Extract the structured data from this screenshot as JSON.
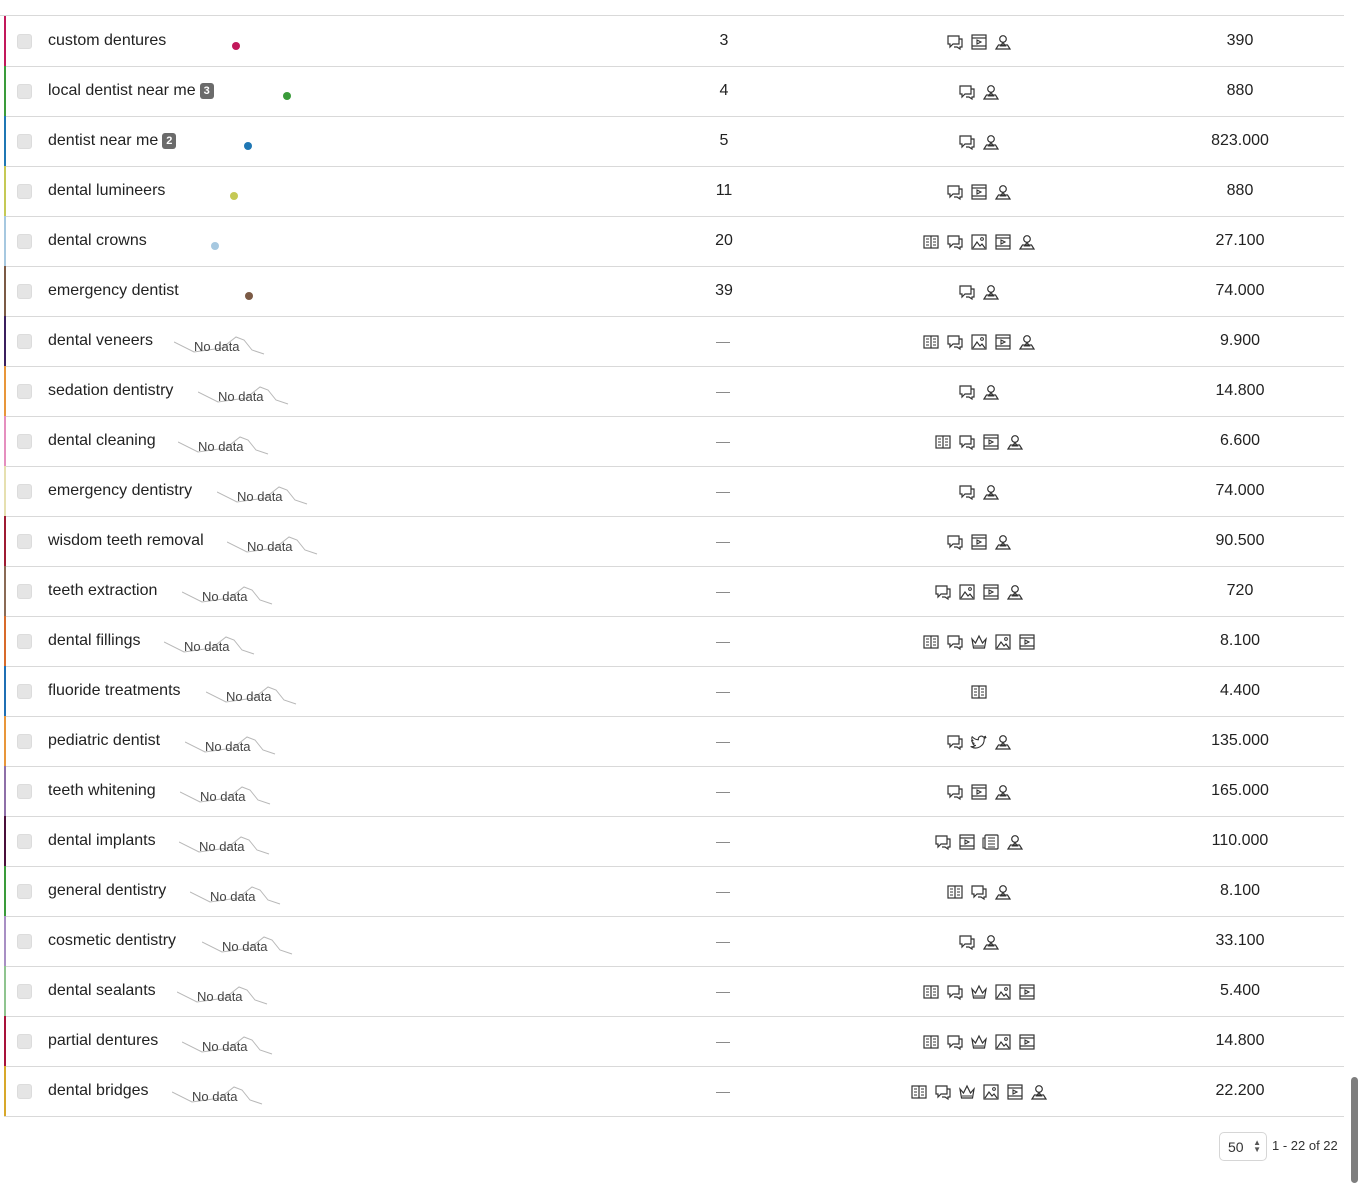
{
  "table": {
    "no_data_label": "No data",
    "rows": [
      {
        "keyword": "custom dentures",
        "badge": "",
        "position": "3",
        "volume": "390",
        "color": "#c2185b",
        "icons": [
          "ads-icon",
          "video-icon",
          "local-pack-icon"
        ],
        "trend": "dot"
      },
      {
        "keyword": "local dentist near me",
        "badge": "3",
        "position": "4",
        "volume": "880",
        "color": "#3a9b3a",
        "icons": [
          "ads-icon",
          "local-pack-icon"
        ],
        "trend": "dot"
      },
      {
        "keyword": "dentist near me",
        "badge": "2",
        "position": "5",
        "volume": "823.000",
        "color": "#1f77b4",
        "icons": [
          "ads-icon",
          "local-pack-icon"
        ],
        "trend": "dot"
      },
      {
        "keyword": "dental lumineers",
        "badge": "",
        "position": "11",
        "volume": "880",
        "color": "#c5c955",
        "icons": [
          "ads-icon",
          "video-icon",
          "local-pack-icon"
        ],
        "trend": "dot"
      },
      {
        "keyword": "dental crowns",
        "badge": "",
        "position": "20",
        "volume": "27.100",
        "color": "#a6c8e0",
        "icons": [
          "knowledge-panel-icon",
          "ads-icon",
          "image-pack-icon",
          "video-icon",
          "local-pack-icon"
        ],
        "trend": "dot"
      },
      {
        "keyword": "emergency dentist",
        "badge": "",
        "position": "39",
        "volume": "74.000",
        "color": "#7b5a45",
        "icons": [
          "ads-icon",
          "local-pack-icon"
        ],
        "trend": "dot"
      },
      {
        "keyword": "dental veneers",
        "badge": "",
        "position": "",
        "volume": "9.900",
        "color": "#3b1f5e",
        "icons": [
          "knowledge-panel-icon",
          "ads-icon",
          "image-pack-icon",
          "video-icon",
          "local-pack-icon"
        ],
        "trend": "nodata"
      },
      {
        "keyword": "sedation dentistry",
        "badge": "",
        "position": "",
        "volume": "14.800",
        "color": "#e8963a",
        "icons": [
          "ads-icon",
          "local-pack-icon"
        ],
        "trend": "nodata"
      },
      {
        "keyword": "dental cleaning",
        "badge": "",
        "position": "",
        "volume": "6.600",
        "color": "#e58fbf",
        "icons": [
          "knowledge-panel-icon",
          "ads-icon",
          "video-icon",
          "local-pack-icon"
        ],
        "trend": "nodata"
      },
      {
        "keyword": "emergency dentistry",
        "badge": "",
        "position": "",
        "volume": "74.000",
        "color": "#e6e0b0",
        "icons": [
          "ads-icon",
          "local-pack-icon"
        ],
        "trend": "nodata"
      },
      {
        "keyword": "wisdom teeth removal",
        "badge": "",
        "position": "",
        "volume": "90.500",
        "color": "#9e1b32",
        "icons": [
          "ads-icon",
          "video-icon",
          "local-pack-icon"
        ],
        "trend": "nodata"
      },
      {
        "keyword": "teeth extraction",
        "badge": "",
        "position": "",
        "volume": "720",
        "color": "#8a6a55",
        "icons": [
          "ads-icon",
          "image-pack-icon",
          "video-icon",
          "local-pack-icon"
        ],
        "trend": "nodata"
      },
      {
        "keyword": "dental fillings",
        "badge": "",
        "position": "",
        "volume": "8.100",
        "color": "#d86a2a",
        "icons": [
          "knowledge-panel-icon",
          "ads-icon",
          "crown-icon",
          "image-pack-icon",
          "video-icon"
        ],
        "trend": "nodata"
      },
      {
        "keyword": "fluoride treatments",
        "badge": "",
        "position": "",
        "volume": "4.400",
        "color": "#1f6fb4",
        "icons": [
          "knowledge-panel-icon"
        ],
        "trend": "nodata"
      },
      {
        "keyword": "pediatric dentist",
        "badge": "",
        "position": "",
        "volume": "135.000",
        "color": "#e8963a",
        "icons": [
          "ads-icon",
          "twitter-icon",
          "local-pack-icon"
        ],
        "trend": "nodata"
      },
      {
        "keyword": "teeth whitening",
        "badge": "",
        "position": "",
        "volume": "165.000",
        "color": "#8e6fa8",
        "icons": [
          "ads-icon",
          "video-icon",
          "local-pack-icon"
        ],
        "trend": "nodata"
      },
      {
        "keyword": "dental implants",
        "badge": "",
        "position": "",
        "volume": "110.000",
        "color": "#4a0f3a",
        "icons": [
          "ads-icon",
          "video-icon",
          "news-icon",
          "local-pack-icon"
        ],
        "trend": "nodata"
      },
      {
        "keyword": "general dentistry",
        "badge": "",
        "position": "",
        "volume": "8.100",
        "color": "#3a9b3a",
        "icons": [
          "knowledge-panel-icon",
          "ads-icon",
          "local-pack-icon"
        ],
        "trend": "nodata"
      },
      {
        "keyword": "cosmetic dentistry",
        "badge": "",
        "position": "",
        "volume": "33.100",
        "color": "#a88fc4",
        "icons": [
          "ads-icon",
          "local-pack-icon"
        ],
        "trend": "nodata"
      },
      {
        "keyword": "dental sealants",
        "badge": "",
        "position": "",
        "volume": "5.400",
        "color": "#8fc48f",
        "icons": [
          "knowledge-panel-icon",
          "ads-icon",
          "crown-icon",
          "image-pack-icon",
          "video-icon"
        ],
        "trend": "nodata"
      },
      {
        "keyword": "partial dentures",
        "badge": "",
        "position": "",
        "volume": "14.800",
        "color": "#a8123a",
        "icons": [
          "knowledge-panel-icon",
          "ads-icon",
          "crown-icon",
          "image-pack-icon",
          "video-icon"
        ],
        "trend": "nodata"
      },
      {
        "keyword": "dental bridges",
        "badge": "",
        "position": "",
        "volume": "22.200",
        "color": "#d8a82a",
        "icons": [
          "knowledge-panel-icon",
          "ads-icon",
          "crown-icon",
          "image-pack-icon",
          "video-icon",
          "local-pack-icon"
        ],
        "trend": "nodata"
      }
    ]
  },
  "pagination": {
    "per_page": "50",
    "range": "1 - 22 of 22"
  }
}
